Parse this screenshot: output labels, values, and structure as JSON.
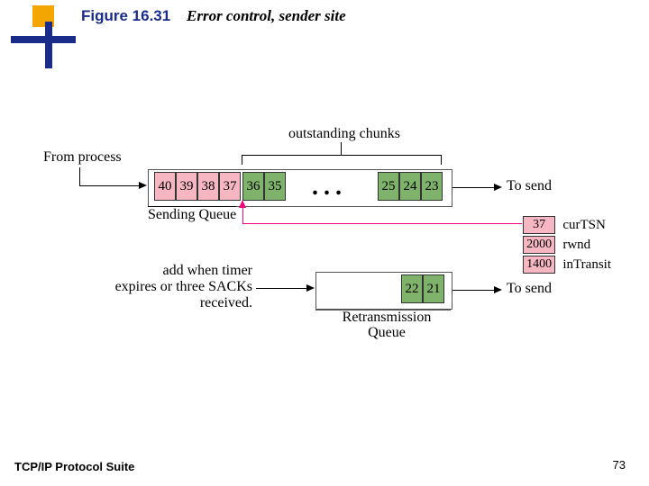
{
  "header": {
    "figure_no": "Figure 16.31",
    "title": "Error control, sender site"
  },
  "footer": {
    "text": "TCP/IP Protocol Suite",
    "page": "73"
  },
  "diagram": {
    "labels": {
      "from_process": "From process",
      "outstanding": "outstanding chunks",
      "sending_queue": "Sending Queue",
      "to_send_1": "To send",
      "to_send_2": "To send",
      "retrans_queue": "Retransmission\nQueue",
      "retrans_note": "add when timer\nexpires or three SACKs\nreceived.",
      "dots": "..."
    },
    "sending_queue": {
      "left_pink": [
        "40",
        "39",
        "38",
        "37"
      ],
      "left_green": [
        "36",
        "35"
      ],
      "right_green": [
        "25",
        "24",
        "23"
      ]
    },
    "retransmission_queue": {
      "green": [
        "22",
        "21"
      ]
    },
    "state": {
      "curTSN": {
        "value": "37",
        "label": "curTSN"
      },
      "rwnd": {
        "value": "2000",
        "label": "rwnd"
      },
      "inTransit": {
        "value": "1400",
        "label": "inTransit"
      }
    }
  }
}
